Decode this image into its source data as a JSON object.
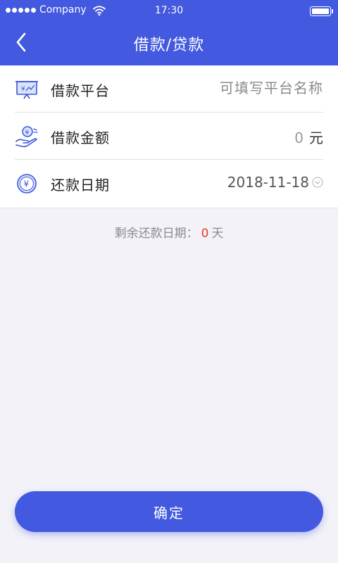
{
  "status_bar": {
    "carrier": "Company",
    "time": "17:30",
    "battery": "full"
  },
  "nav": {
    "back_icon": "chevron-left-icon",
    "title": "借款/贷款"
  },
  "form": {
    "platform": {
      "label": "借款平台",
      "placeholder": "可填写平台名称",
      "value": "",
      "icon": "monitor-yen-icon"
    },
    "amount": {
      "label": "借款金额",
      "value": "0",
      "unit": "元",
      "icon": "hand-coin-icon"
    },
    "date": {
      "label": "还款日期",
      "value": "2018-11-18",
      "icon": "yen-coin-icon"
    }
  },
  "remaining": {
    "label": "剩余还款日期：",
    "value": "0",
    "unit": "天"
  },
  "confirm_label": "确定",
  "colors": {
    "primary": "#4259e0",
    "background": "#f3f2f8",
    "highlight": "#e6402a"
  }
}
